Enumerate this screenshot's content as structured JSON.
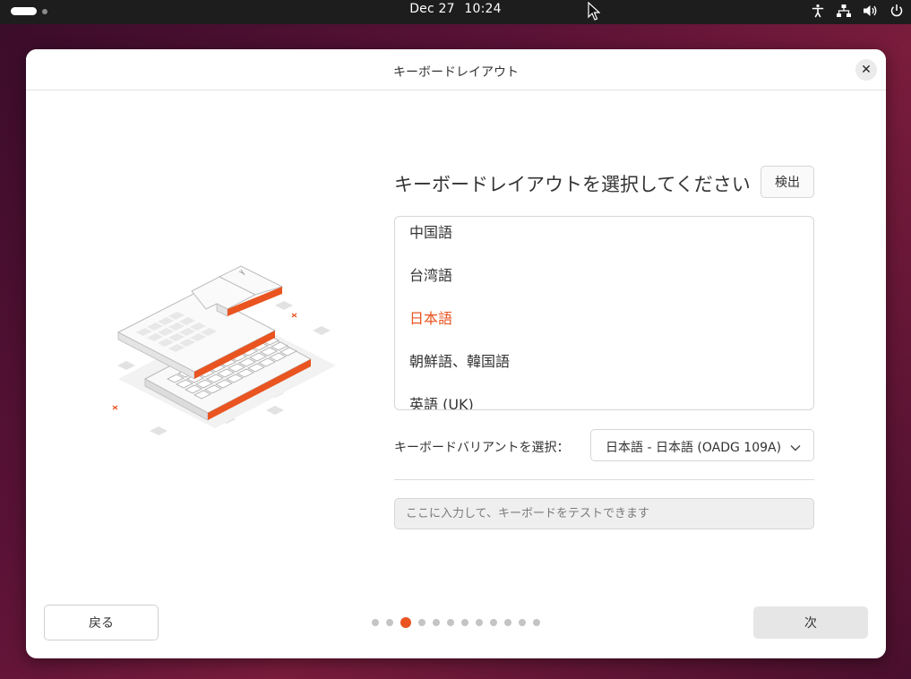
{
  "topbar": {
    "date": "Dec 27",
    "time": "10:24",
    "tray_icons": [
      "accessibility-icon",
      "network-icon",
      "volume-icon",
      "power-icon"
    ]
  },
  "window": {
    "title": "キーボードレイアウト",
    "heading": "キーボードレイアウトを選択してください",
    "detect_label": "検出",
    "layouts": [
      {
        "label": "中国語",
        "selected": false
      },
      {
        "label": "台湾語",
        "selected": false
      },
      {
        "label": "日本語",
        "selected": true
      },
      {
        "label": "朝鮮語、韓国語",
        "selected": false
      },
      {
        "label": "英語 (UK)",
        "selected": false
      }
    ],
    "variant_label": "キーボードバリアントを選択：",
    "variant_value": "日本語 - 日本語 (OADG 109A)",
    "test_placeholder": "ここに入力して、キーボードをテストできます",
    "back_label": "戻る",
    "next_label": "次",
    "pager": {
      "total": 12,
      "current": 3
    }
  },
  "colors": {
    "accent": "#e95420",
    "topbar": "#1d1d1d"
  }
}
